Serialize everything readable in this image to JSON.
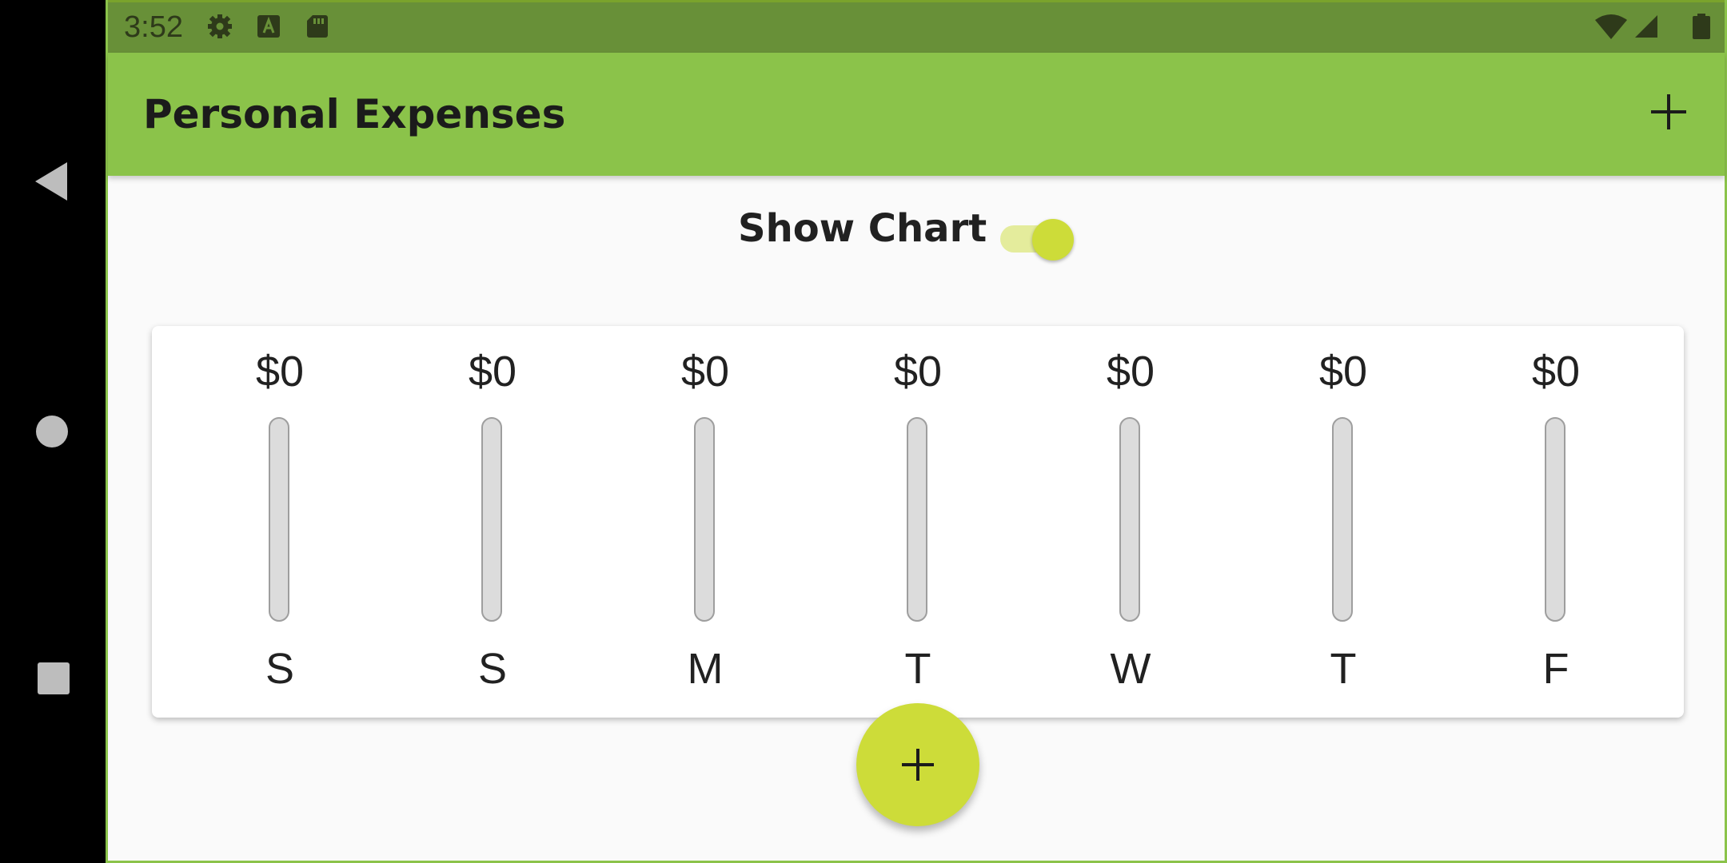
{
  "status_bar": {
    "time": "3:52",
    "left_icons": [
      "gear-icon",
      "keyboard-a-icon",
      "sd-card-icon"
    ],
    "right_icons": [
      "wifi-icon",
      "cell-signal-icon",
      "battery-icon"
    ]
  },
  "nav": {
    "buttons": [
      "back-icon",
      "home-icon",
      "recents-icon"
    ]
  },
  "app_bar": {
    "title": "Personal Expenses",
    "action_icon": "add-icon"
  },
  "toggle": {
    "label": "Show Chart",
    "on": true
  },
  "colors": {
    "primary": "#8bc34a",
    "accent": "#cddc39",
    "status_bar": "#689038",
    "background": "#fafafa"
  },
  "chart_data": {
    "type": "bar",
    "categories": [
      "S",
      "S",
      "M",
      "T",
      "W",
      "T",
      "F"
    ],
    "amount_labels": [
      "$0",
      "$0",
      "$0",
      "$0",
      "$0",
      "$0",
      "$0"
    ],
    "values": [
      0,
      0,
      0,
      0,
      0,
      0,
      0
    ],
    "fill_fraction": [
      0,
      0,
      0,
      0,
      0,
      0,
      0
    ]
  },
  "fab": {
    "icon": "add-icon"
  }
}
